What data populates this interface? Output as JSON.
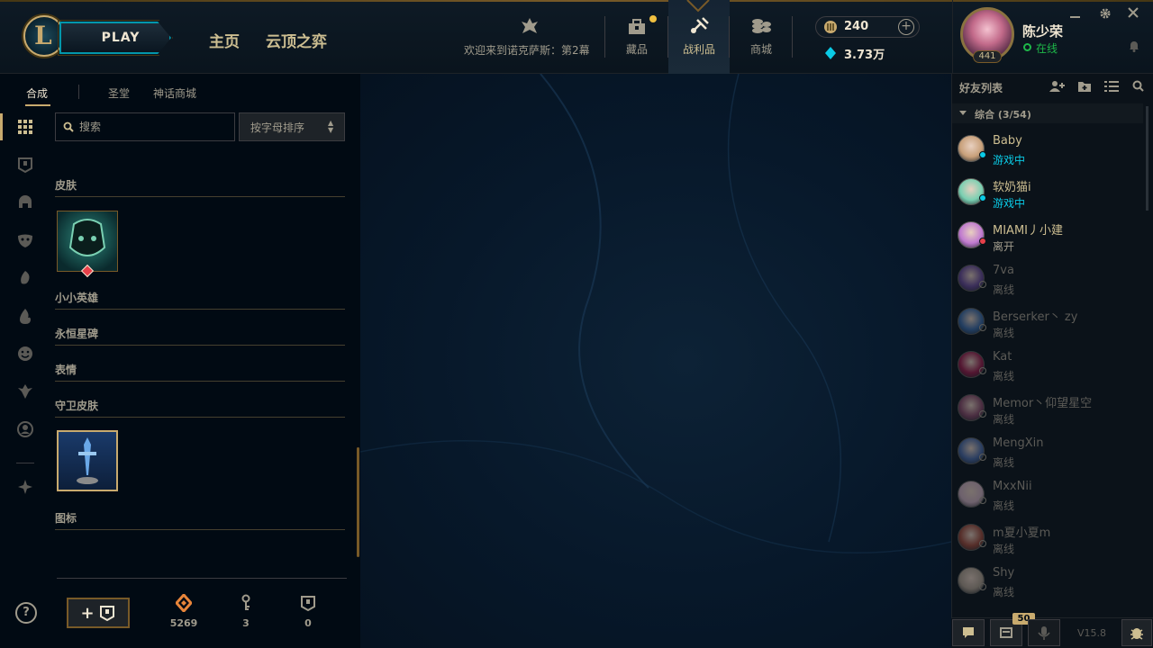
{
  "header": {
    "logo_letter": "L",
    "play_label": "PLAY",
    "nav": [
      "主页",
      "云顶之弈"
    ],
    "welcome_text": "欢迎来到诺克萨斯：第2幕",
    "buttons": [
      {
        "label": "藏品",
        "icon": "chest-icon"
      },
      {
        "label": "战利品",
        "icon": "loot-icon"
      },
      {
        "label": "商城",
        "icon": "coins-icon"
      }
    ],
    "rp": "240",
    "blue_essence": "3.73万",
    "profile": {
      "name": "陈少荣",
      "status": "在线",
      "level": "441"
    }
  },
  "left_panel": {
    "tabs": [
      "合成",
      "圣堂",
      "神话商城"
    ],
    "search_placeholder": "搜索",
    "sort_label": "按字母排序",
    "categories": [
      "皮肤",
      "小小英雄",
      "永恒星碑",
      "表情",
      "守卫皮肤",
      "图标"
    ],
    "resources": [
      {
        "value": "5269",
        "icon": "orange-essence-icon"
      },
      {
        "value": "3",
        "icon": "key-icon"
      },
      {
        "value": "0",
        "icon": "chest-icon"
      }
    ],
    "add_chest_label": "+",
    "help_label": "?"
  },
  "friends": {
    "title": "好友列表",
    "group_label": "综合 (3/54)",
    "list": [
      {
        "name": "Baby",
        "status": "游戏中",
        "state": "ingame"
      },
      {
        "name": "软奶猫i",
        "status": "游戏中",
        "state": "ingame"
      },
      {
        "name": "MIAMI丿小建",
        "status": "离开",
        "state": "away"
      },
      {
        "name": "7va",
        "status": "离线",
        "state": "offline"
      },
      {
        "name": "Berserker丶 zy",
        "status": "离线",
        "state": "offline"
      },
      {
        "name": "Kat",
        "status": "离线",
        "state": "offline"
      },
      {
        "name": "Memor丶仰望星空",
        "status": "离线",
        "state": "offline"
      },
      {
        "name": "MengXin",
        "status": "离线",
        "state": "offline"
      },
      {
        "name": "MxxNii",
        "status": "离线",
        "state": "offline"
      },
      {
        "name": "m夏小夏m",
        "status": "离线",
        "state": "offline"
      },
      {
        "name": "Shy",
        "status": "离线",
        "state": "offline"
      }
    ],
    "badge": "50",
    "version": "V15.8"
  },
  "colors": {
    "gold": "#c8aa6e",
    "teal": "#0397ab",
    "online": "#1eb849",
    "ingame": "#0acbe6",
    "away": "#e8404a",
    "offline": "#5b5a56"
  }
}
